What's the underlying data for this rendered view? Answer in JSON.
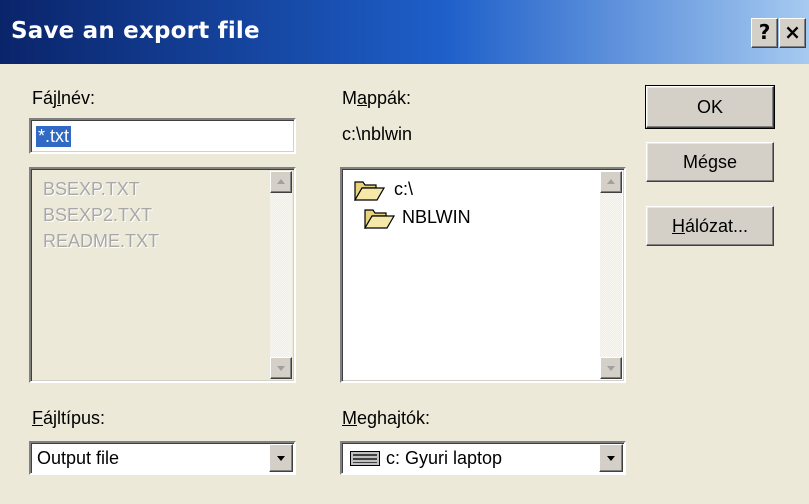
{
  "dialog": {
    "title": "Save an export file",
    "help_label": "?",
    "close_label": "×"
  },
  "filename": {
    "label_pre": "Fáj",
    "label_ul": "l",
    "label_post": "név:",
    "value": "*.txt",
    "files": [
      "BSEXP.TXT",
      "BSEXP2.TXT",
      "README.TXT"
    ]
  },
  "folders": {
    "label_pre": "M",
    "label_ul": "a",
    "label_post": "ppák:",
    "current_path": "c:\\nblwin",
    "items": [
      {
        "name": "c:\\",
        "icon": "open-folder-icon"
      },
      {
        "name": "NBLWIN",
        "icon": "open-folder-icon"
      }
    ]
  },
  "filetype": {
    "label_ul": "F",
    "label_post": "ájltípus:",
    "selected": "Output file"
  },
  "drives": {
    "label_ul": "M",
    "label_post": "eghajtók:",
    "selected": "c: Gyuri laptop",
    "icon": "drive-icon"
  },
  "buttons": {
    "ok": "OK",
    "cancel": "Mégse",
    "network_ul": "H",
    "network_post": "álózat..."
  }
}
